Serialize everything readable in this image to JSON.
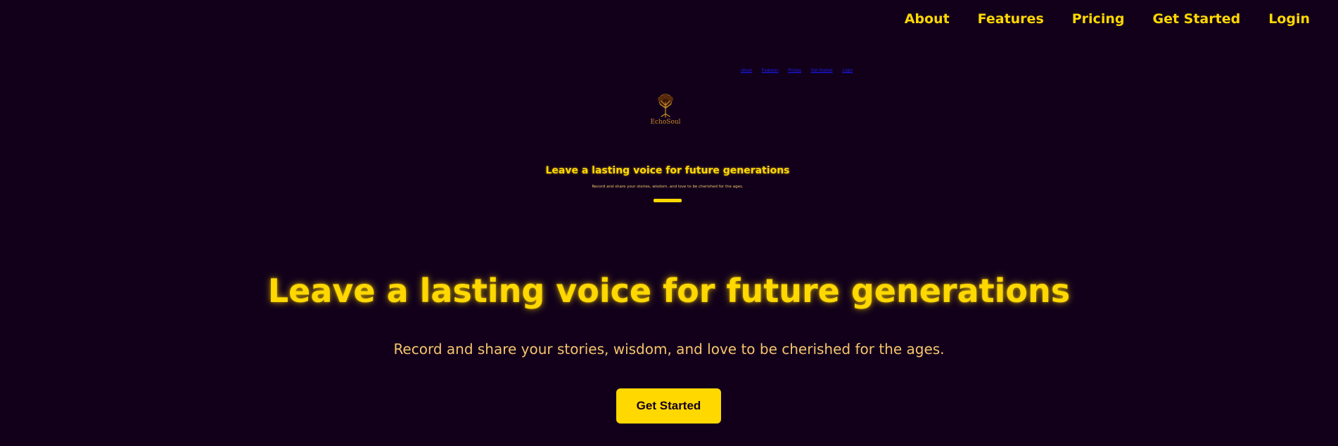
{
  "nav": {
    "items": [
      {
        "label": "About"
      },
      {
        "label": "Features"
      },
      {
        "label": "Pricing"
      },
      {
        "label": "Get Started"
      },
      {
        "label": "Login"
      }
    ]
  },
  "preview": {
    "nav": {
      "items": [
        {
          "label": "About"
        },
        {
          "label": "Features"
        },
        {
          "label": "Pricing"
        },
        {
          "label": "Get Started"
        },
        {
          "label": "Login"
        }
      ]
    },
    "logo_text": "EchoSoul",
    "headline": "Leave a lasting voice for future generations",
    "subtitle": "Record and share your stories, wisdom, and love to be cherished for the ages."
  },
  "hero": {
    "title": "Leave a lasting voice for future generations",
    "subtitle": "Record and share your stories, wisdom, and love to be cherished for the ages.",
    "cta_label": "Get Started"
  },
  "colors": {
    "background": "#12001b",
    "accent": "#ffd800",
    "subtitle": "#f6c46c",
    "preview_link": "#1c1cff",
    "logo": "#c98a24"
  },
  "icons": {
    "logo": "tree-icon"
  }
}
